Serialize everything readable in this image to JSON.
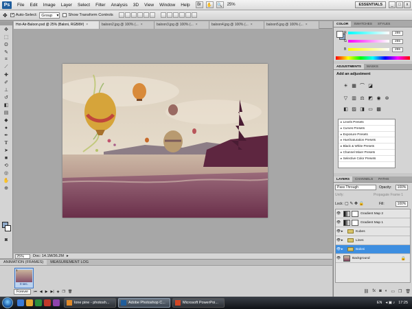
{
  "menubar": {
    "logo": "Ps",
    "items": [
      "File",
      "Edit",
      "Image",
      "Layer",
      "Select",
      "Filter",
      "Analysis",
      "3D",
      "View",
      "Window",
      "Help"
    ],
    "zoom": "25%",
    "workspace": "ESSENTIALS",
    "win_controls": [
      "_",
      "□",
      "x"
    ]
  },
  "options": {
    "auto_select_label": "Auto-Select:",
    "auto_select_value": "Group",
    "show_transform_label": "Show Transform Controls"
  },
  "tabs": [
    {
      "label": "Hot-Air-Baloon.psd @ 25% (Baloni, RGB/8#)",
      "active": true
    },
    {
      "label": "baloon2.jpg @ 100% (...",
      "active": false
    },
    {
      "label": "baloon3.jpg @ 100% (...",
      "active": false
    },
    {
      "label": "baloon4.jpg @ 100% (...",
      "active": false
    },
    {
      "label": "baloon5.jpg @ 100% (...",
      "active": false
    }
  ],
  "status": {
    "zoom": "25%",
    "doc": "Doc: 14.1M/36.2M"
  },
  "animation": {
    "tabs": [
      "ANIMATION (FRAMES)",
      "MEASUREMENT LOG"
    ],
    "frame_number": "1",
    "frame_delay": "0 sec.",
    "loop": "Forever"
  },
  "color_panel": {
    "tabs": [
      "COLOR",
      "SWATCHES",
      "STYLES"
    ],
    "channels": [
      {
        "label": "R",
        "value": "255"
      },
      {
        "label": "G",
        "value": "255"
      },
      {
        "label": "B",
        "value": "255"
      }
    ]
  },
  "adjustments": {
    "tabs": [
      "ADJUSTMENTS",
      "MASKS"
    ],
    "title": "Add an adjustment",
    "presets": [
      "Levels Presets",
      "Curves Presets",
      "Exposure Presets",
      "Hue/Saturation Presets",
      "Black & White Presets",
      "Channel Mixer Presets",
      "Selective Color Presets"
    ]
  },
  "layers": {
    "tabs": [
      "LAYERS",
      "CHANNELS",
      "PATHS"
    ],
    "blend_mode": "Pass Through",
    "opacity_label": "Opacity:",
    "opacity": "100%",
    "unify_label": "Unify:",
    "propagate_label": "Propagate Frame 1",
    "lock_label": "Lock:",
    "fill_label": "Fill:",
    "fill": "100%",
    "items": [
      {
        "name": "Gradient Map 2",
        "kind": "adjustment"
      },
      {
        "name": "Gradient Map 1",
        "kind": "adjustment"
      },
      {
        "name": "Kubes",
        "kind": "group"
      },
      {
        "name": "Lines",
        "kind": "group"
      },
      {
        "name": "Baloni",
        "kind": "group",
        "selected": true
      },
      {
        "name": "Background",
        "kind": "image",
        "locked": true
      }
    ]
  },
  "taskbar": {
    "tasks": [
      {
        "label": "lone pine - photosh...",
        "active": false
      },
      {
        "label": "Adobe Photoshop C...",
        "active": true
      },
      {
        "label": "Microsoft PowerPoi...",
        "active": false
      }
    ],
    "lang": "EN",
    "time": "17:25"
  }
}
